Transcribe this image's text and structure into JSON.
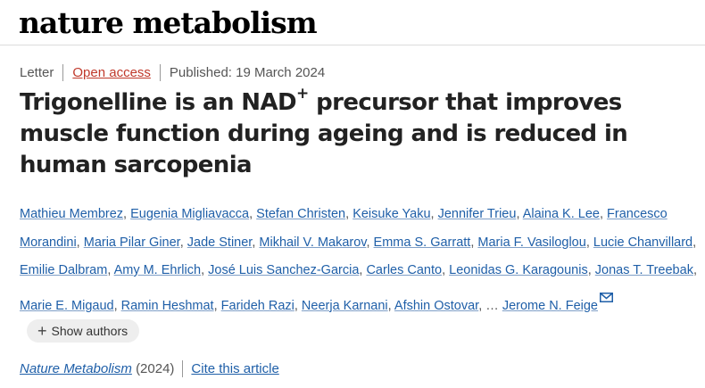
{
  "header": {
    "masthead": "nature metabolism"
  },
  "meta": {
    "type": "Letter",
    "open_access": "Open access",
    "published": "Published: 19 March 2024"
  },
  "article": {
    "title_part1": "Trigonelline is an NAD",
    "title_sup": "+",
    "title_part2": " precursor that improves muscle function during ageing and is reduced in human sarcopenia"
  },
  "authors": [
    "Mathieu Membrez",
    "Eugenia Migliavacca",
    "Stefan Christen",
    "Keisuke Yaku",
    "Jennifer Trieu",
    "Alaina K. Lee",
    "Francesco Morandini",
    "Maria Pilar Giner",
    "Jade Stiner",
    "Mikhail V. Makarov",
    "Emma S. Garratt",
    "Maria F. Vasiloglou",
    "Lucie Chanvillard",
    "Emilie Dalbram",
    "Amy M. Ehrlich",
    "José Luis Sanchez-Garcia",
    "Carles Canto",
    "Leonidas G. Karagounis",
    "Jonas T. Treebak",
    "Marie E. Migaud",
    "Ramin Heshmat",
    "Farideh Razi",
    "Neerja Karnani",
    "Afshin Ostovar"
  ],
  "authors_ellipsis": "…",
  "corresponding_author": "Jerome N. Feige",
  "icons": {
    "corresponding": "mail-icon",
    "expand": "plus-icon"
  },
  "show_authors_label": "Show authors",
  "citation": {
    "journal": "Nature Metabolism",
    "year": "(2024)",
    "cite_label": "Cite this article"
  }
}
